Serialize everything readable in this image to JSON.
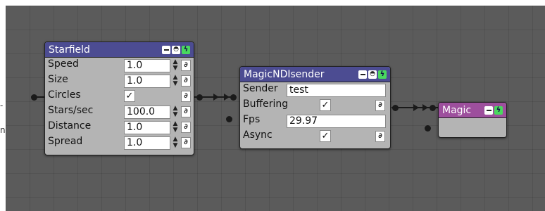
{
  "window_fragment": {
    "text1": "-",
    "text2": "n"
  },
  "starfield": {
    "title": "Starfield",
    "rows": [
      {
        "label": "Speed",
        "value": "1.0"
      },
      {
        "label": "Size",
        "value": "1.0"
      },
      {
        "label": "Circles",
        "checked": "✓"
      },
      {
        "label": "Stars/sec",
        "value": "100.0"
      },
      {
        "label": "Distance",
        "value": "1.0"
      },
      {
        "label": "Spread",
        "value": "1.0"
      }
    ]
  },
  "ndisender": {
    "title": "MagicNDIsender",
    "sender_label": "Sender",
    "sender_value": "test",
    "buffering_label": "Buffering",
    "buffering_checked": "✓",
    "fps_label": "Fps",
    "fps_value": "29.97",
    "async_label": "Async",
    "async_checked": "✓"
  },
  "magic": {
    "title": "Magic"
  },
  "icons": {
    "minimize": "minimize-icon",
    "eye": "eye-icon",
    "bolt": "bolt-icon",
    "link": "link-icon",
    "spinner": "spinner-arrows-icon",
    "check": "checkmark-icon"
  },
  "colors": {
    "canvas": "#5b5b5b",
    "node_body": "#b4b4b4",
    "header_blue": "#4c4c92",
    "header_purple": "#9d4f9d",
    "bolt_green": "#49d85e"
  }
}
